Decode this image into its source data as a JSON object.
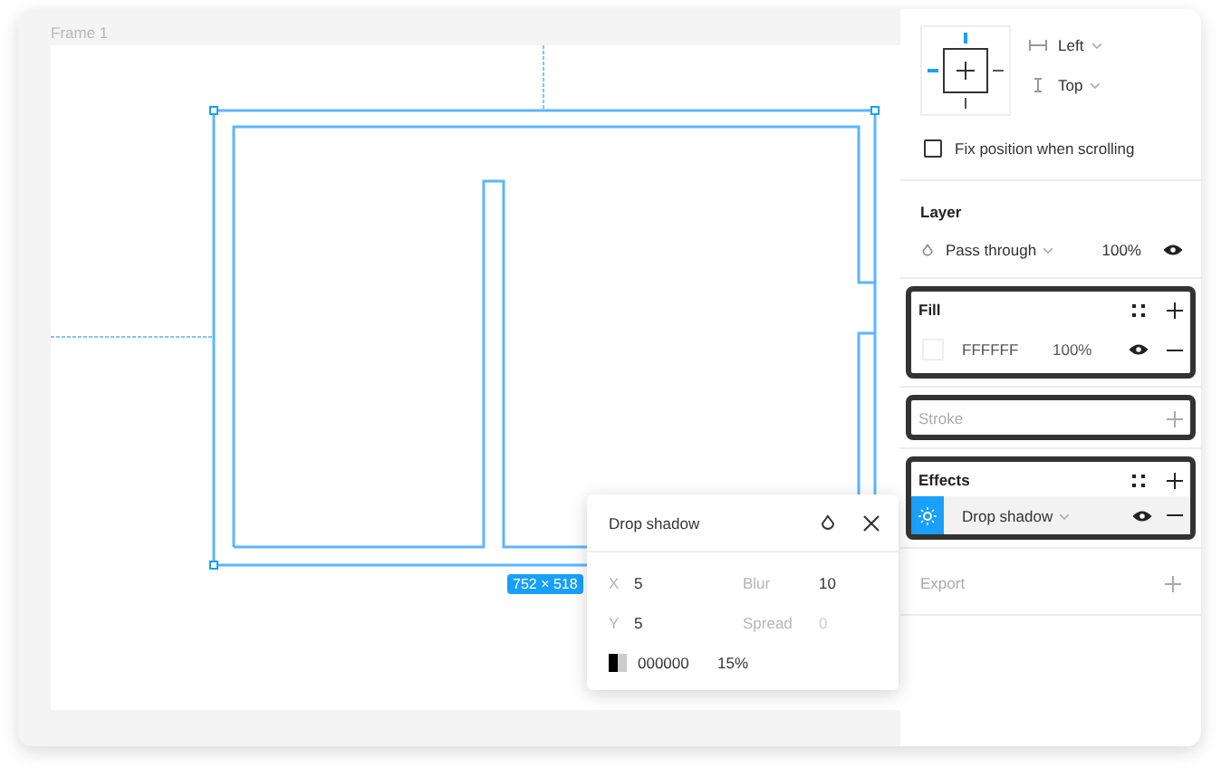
{
  "canvas": {
    "frame_label": "Frame 1",
    "size_badge": "752 × 518"
  },
  "constraints": {
    "horizontal": "Left",
    "vertical": "Top",
    "fix_position": {
      "label": "Fix position when scrolling",
      "checked": false
    }
  },
  "layer": {
    "title": "Layer",
    "blend": "Pass through",
    "opacity": "100%",
    "visible": true
  },
  "fill": {
    "title": "Fill",
    "highlighted": true,
    "items": [
      {
        "hex": "FFFFFF",
        "opacity": "100%",
        "color": "#ffffff",
        "visible": true
      }
    ]
  },
  "stroke": {
    "title": "Stroke",
    "highlighted": true
  },
  "effects": {
    "title": "Effects",
    "highlighted": true,
    "items": [
      {
        "name": "Drop shadow",
        "selected": true,
        "visible": true
      }
    ]
  },
  "export": {
    "title": "Export"
  },
  "popup": {
    "title": "Drop shadow",
    "fields": [
      {
        "label": "X",
        "value": "5"
      },
      {
        "label": "Blur",
        "value": "10"
      },
      {
        "label": "Y",
        "value": "5"
      },
      {
        "label": "Spread",
        "placeholder": "0"
      }
    ],
    "hex": "000000",
    "opacity": "15%"
  }
}
